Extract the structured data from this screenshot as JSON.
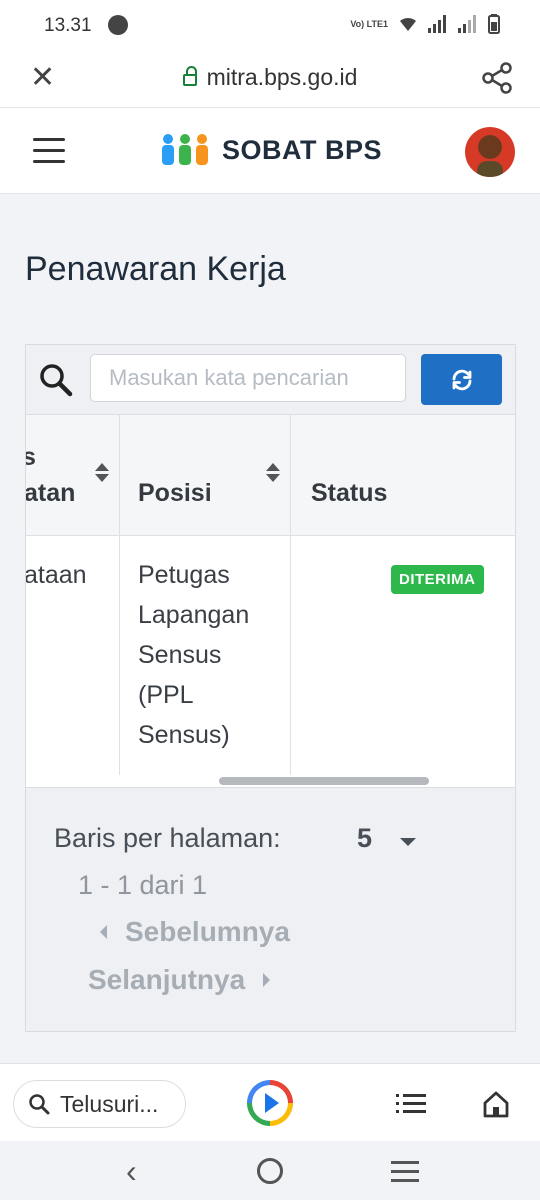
{
  "status_bar": {
    "time": "13.31",
    "network_label": "Vo) LTE1"
  },
  "browser": {
    "url": "mitra.bps.go.id",
    "search_placeholder": "Telusuri..."
  },
  "app": {
    "title": "SOBAT BPS"
  },
  "page": {
    "title": "Penawaran Kerja"
  },
  "search": {
    "placeholder": "Masukan kata pencarian"
  },
  "table": {
    "columns": [
      {
        "label_line1": "s",
        "label_line2": "atan"
      },
      {
        "label": "Posisi"
      },
      {
        "label": "Status"
      }
    ],
    "rows": [
      {
        "col1": "ataan",
        "posisi_lines": [
          "Petugas",
          "Lapangan",
          "Sensus",
          "(PPL",
          "Sensus)"
        ],
        "status": "DITERIMA"
      }
    ]
  },
  "pagination": {
    "rows_per_page_label": "Baris per halaman:",
    "rows_per_page_value": "5",
    "range": "1 - 1 dari 1",
    "prev_label": "Sebelumnya",
    "next_label": "Selanjutnya"
  },
  "colors": {
    "primary": "#1f6fc5",
    "success": "#2db84b",
    "lock_green": "#188038"
  },
  "icons": [
    "close-icon",
    "lock-icon",
    "share-icon",
    "hamburger-icon",
    "people-logo-icon",
    "search-icon",
    "refresh-icon",
    "sort-icon",
    "chevron-down-icon",
    "play-icon",
    "list-icon",
    "home-icon"
  ]
}
